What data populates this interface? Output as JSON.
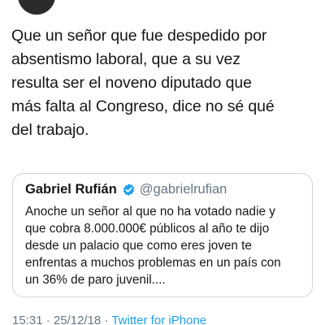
{
  "tweet": {
    "text": "Que un señor que fue despedido por\nabsentismo laboral, que a su vez\nresulta ser el noveno diputado que\nmás falta al Congreso, dice no sé qué\ndel trabajo."
  },
  "quote": {
    "name": "Gabriel Rufián",
    "handle": "@gabrielrufian",
    "verified_icon": "verified-badge-icon",
    "text": "Anoche un señor al que no ha votado  nadie y\nque cobra 8.000.000€ públicos al año te dijo\ndesde un palacio que como eres joven te\nenfrentas a muchos problemas en un país con\nun 36% de paro juvenil...."
  },
  "meta": {
    "time": "15:31",
    "separator": " · ",
    "date": "25/12/18",
    "source": "Twitter for iPhone"
  },
  "colors": {
    "text": "#14171a",
    "secondary": "#657786",
    "link": "#1da1f2",
    "border": "#ccd6dd"
  }
}
